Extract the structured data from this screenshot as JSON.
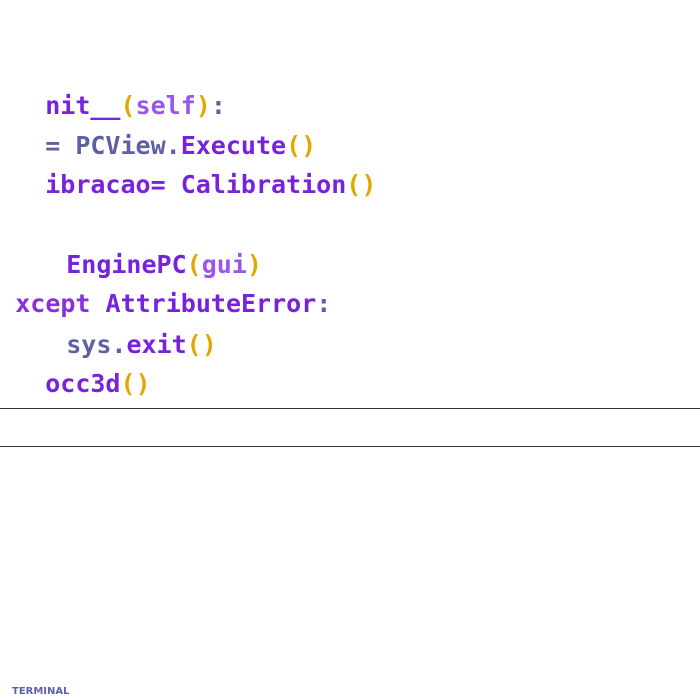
{
  "editor": {
    "lines": [
      {
        "tokens": [
          {
            "text": "nit__",
            "kind": "fn"
          },
          {
            "text": "(",
            "kind": "paren"
          },
          {
            "text": "self",
            "kind": "self"
          },
          {
            "text": ")",
            "kind": "paren"
          },
          {
            "text": ":",
            "kind": "plain"
          }
        ]
      },
      {
        "tokens": [
          {
            "text": "= ",
            "kind": "plain"
          },
          {
            "text": "PCView",
            "kind": "plain"
          },
          {
            "text": ".",
            "kind": "plain"
          },
          {
            "text": "Execute",
            "kind": "fn"
          },
          {
            "text": "()",
            "kind": "paren"
          }
        ]
      },
      {
        "tokens": [
          {
            "text": "ibracao= ",
            "kind": "fn"
          },
          {
            "text": "Calibration",
            "kind": "fn"
          },
          {
            "text": "()",
            "kind": "paren"
          }
        ]
      },
      {
        "tokens": [
          {
            "text": "EnginePC",
            "kind": "fn"
          },
          {
            "text": "(",
            "kind": "paren"
          },
          {
            "text": "gui",
            "kind": "self"
          },
          {
            "text": ")",
            "kind": "paren"
          }
        ]
      },
      {
        "tokens": [
          {
            "text": "xcept ",
            "kind": "kw"
          },
          {
            "text": "AttributeError",
            "kind": "fn"
          },
          {
            "text": ":",
            "kind": "plain"
          }
        ]
      },
      {
        "tokens": [
          {
            "text": "sys",
            "kind": "plain"
          },
          {
            "text": ".",
            "kind": "plain"
          },
          {
            "text": "exit",
            "kind": "fn"
          },
          {
            "text": "()",
            "kind": "paren"
          }
        ]
      },
      {
        "tokens": [
          {
            "text": "occ3d",
            "kind": "fn"
          },
          {
            "text": "()",
            "kind": "paren"
          }
        ]
      }
    ]
  },
  "panel": {
    "terminal_tab_label": "TERMINAL"
  },
  "colors": {
    "function": "#7722dd",
    "paren": "#e0a800",
    "self": "#9955ee",
    "plain": "#5f5fa8",
    "keyword": "#8a2ee0"
  }
}
